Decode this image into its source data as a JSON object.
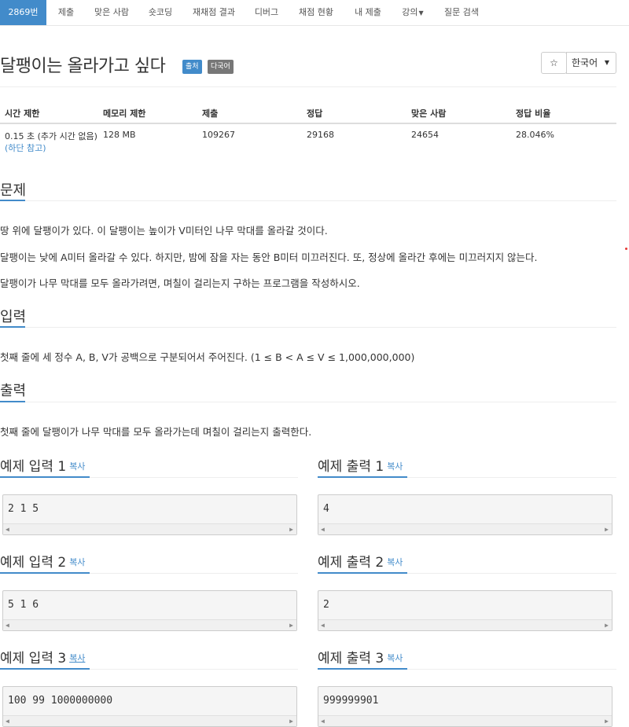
{
  "nav": {
    "items": [
      "2869번",
      "제출",
      "맞은 사람",
      "숏코딩",
      "재채점 결과",
      "디버그",
      "채점 현황",
      "내 제출",
      "강의",
      "질문 검색"
    ]
  },
  "problem": {
    "title": "달팽이는 올라가고 싶다",
    "label_source": "출처",
    "label_lang": "다국어",
    "star_icon": "☆",
    "language": "한국어"
  },
  "info": {
    "headers": [
      "시간 제한",
      "메모리 제한",
      "제출",
      "정답",
      "맞은 사람",
      "정답 비율"
    ],
    "time": "0.15 초 (추가 시간 없음)",
    "time_note": "(하단 참고)",
    "memory": "128 MB",
    "submissions": "109267",
    "accepted": "29168",
    "solved": "24654",
    "ratio": "28.046%"
  },
  "sections": {
    "problem_title": "문제",
    "problem_lines": [
      "땅 위에 달팽이가 있다. 이 달팽이는 높이가 V미터인 나무 막대를 올라갈 것이다.",
      "달팽이는 낮에 A미터 올라갈 수 있다. 하지만, 밤에 잠을 자는 동안 B미터 미끄러진다. 또, 정상에 올라간 후에는 미끄러지지 않는다.",
      "달팽이가 나무 막대를 모두 올라가려면, 며칠이 걸리는지 구하는 프로그램을 작성하시오."
    ],
    "input_title": "입력",
    "input_text": "첫째 줄에 세 정수 A, B, V가 공백으로 구분되어서 주어진다. (1 ≤ B < A ≤ V ≤ 1,000,000,000)",
    "output_title": "출력",
    "output_text": "첫째 줄에 달팽이가 나무 막대를 모두 올라가는데 며칠이 걸리는지 출력한다."
  },
  "samples": {
    "copy_label": "복사",
    "inputs": [
      {
        "title": "예제 입력 1",
        "value": "2 1 5"
      },
      {
        "title": "예제 입력 2",
        "value": "5 1 6"
      },
      {
        "title": "예제 입력 3",
        "value": "100 99 1000000000"
      }
    ],
    "outputs": [
      {
        "title": "예제 출력 1",
        "value": "4"
      },
      {
        "title": "예제 출력 2",
        "value": "2"
      },
      {
        "title": "예제 출력 3",
        "value": "999999901"
      }
    ]
  },
  "colors": {
    "accent": "#428bca",
    "label_gray": "#777777",
    "border": "#eeeeee"
  }
}
